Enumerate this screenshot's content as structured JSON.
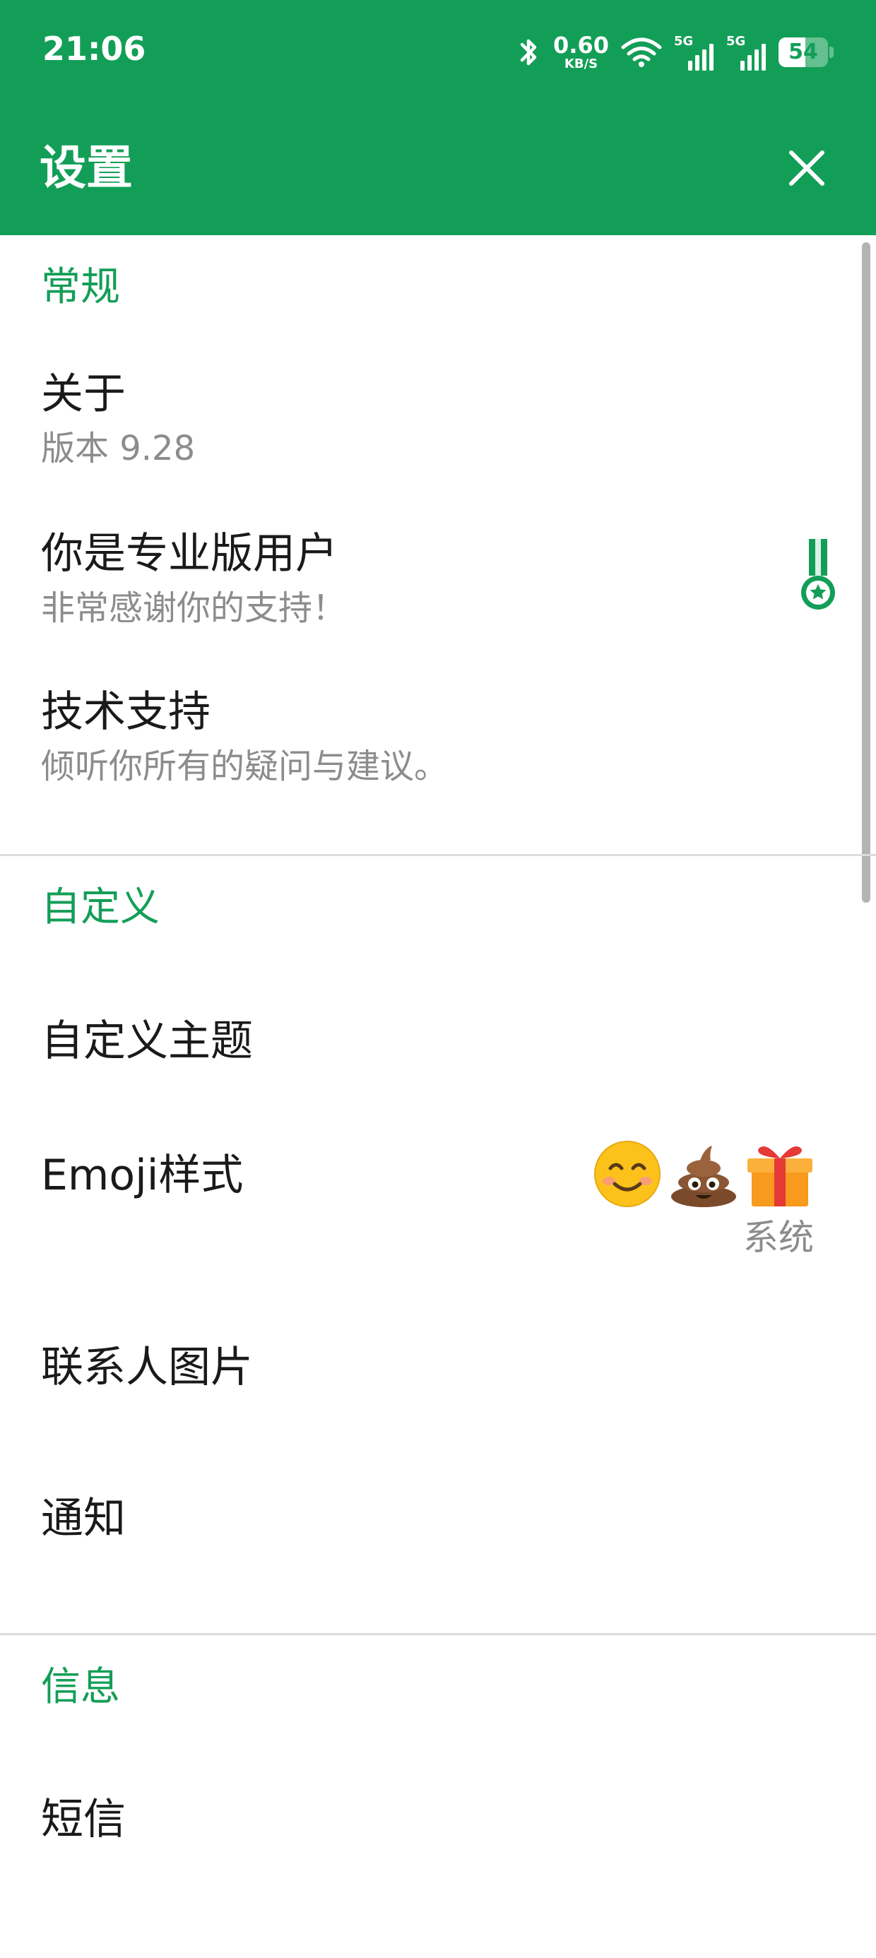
{
  "status_bar": {
    "time": "21:06",
    "net_speed": "0.60",
    "net_unit": "KB/S",
    "sim1_tag": "5G",
    "sim2_tag": "5G",
    "battery_level": "54",
    "battery_fraction": 0.54,
    "icons": [
      "bluetooth-icon",
      "wifi-icon",
      "signal-icon",
      "signal-icon",
      "battery-icon"
    ]
  },
  "app_bar": {
    "title": "设置",
    "close_icon": "close-icon"
  },
  "sections": {
    "general": {
      "header": "常规",
      "about_title": "关于",
      "about_sub": "版本 9.28",
      "pro_title": "你是专业版用户",
      "pro_sub": "非常感谢你的支持！",
      "pro_icon": "medal-icon",
      "support_title": "技术支持",
      "support_sub": "倾听你所有的疑问与建议。"
    },
    "customize": {
      "header": "自定义",
      "theme_title": "自定义主题",
      "emoji_title": "Emoji样式",
      "emoji_value": "系统",
      "emoji_preview": [
        "smiling-face-icon",
        "pile-of-poo-icon",
        "gift-icon"
      ],
      "contact_title": "联系人图片",
      "notify_title": "通知"
    },
    "messages": {
      "header": "信息",
      "sms_title": "短信"
    }
  },
  "colors": {
    "primary": "#139e57",
    "text": "#1a1a1a",
    "secondary_text": "#8c8c8c",
    "divider": "#dcdcdc"
  }
}
